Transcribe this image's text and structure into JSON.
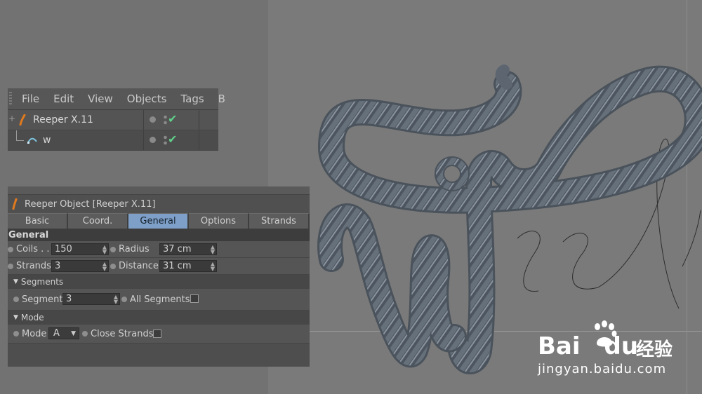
{
  "object_manager": {
    "menu": [
      "File",
      "Edit",
      "View",
      "Objects",
      "Tags",
      "B"
    ],
    "objects": [
      {
        "name": "Reeper X.11",
        "icon": "reeper-icon",
        "enabled": true
      },
      {
        "name": "w",
        "icon": "spline-icon",
        "enabled": true
      }
    ]
  },
  "attribute_manager": {
    "title": "Reeper Object [Reeper X.11]",
    "tabs": [
      "Basic",
      "Coord.",
      "General",
      "Options",
      "Strands"
    ],
    "active_tab": "General",
    "section": "General",
    "params": {
      "coils": {
        "label": "Coils . .",
        "value": "150"
      },
      "radius": {
        "label": "Radius",
        "value": "37 cm"
      },
      "strands": {
        "label": "Strands",
        "value": "3"
      },
      "distance": {
        "label": "Distance",
        "value": "31 cm"
      }
    },
    "segments": {
      "header": "Segments",
      "segment_label": "Segment",
      "segment_value": "3",
      "all_segments_label": "All Segments",
      "all_segments_checked": false
    },
    "mode": {
      "header": "Mode",
      "mode_label": "Mode",
      "mode_value": "A",
      "close_strands_label": "Close Strands",
      "close_strands_checked": false
    }
  },
  "watermark": {
    "brand": "Bai",
    "brand2": "du",
    "chinese": "经验",
    "url": "jingyan.baidu.com"
  },
  "colors": {
    "active_tab": "#7ea0c8",
    "check": "#5fd08a",
    "rope": "#5d6670",
    "viewport": "#7a7a7a"
  }
}
